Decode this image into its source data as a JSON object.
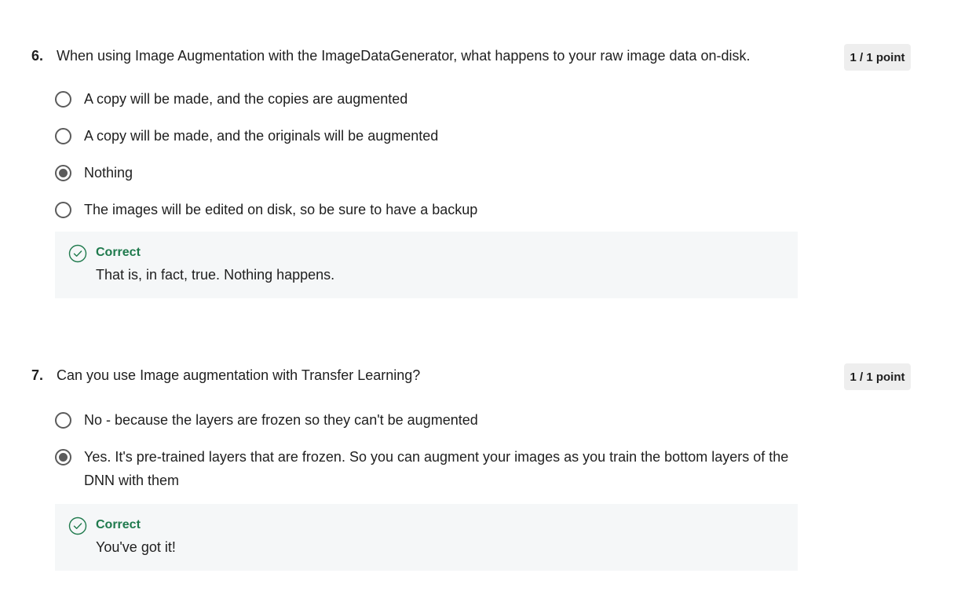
{
  "questions": [
    {
      "number": "6.",
      "text": "When using Image Augmentation with the ImageDataGenerator, what happens to your raw image data on-disk.",
      "points": "1 / 1 point",
      "options": [
        {
          "label": "A copy will be made, and the copies are augmented",
          "selected": false
        },
        {
          "label": "A copy will be made, and the originals will be augmented",
          "selected": false
        },
        {
          "label": "Nothing",
          "selected": true
        },
        {
          "label": "The images will be edited on disk, so be sure to have a backup",
          "selected": false
        }
      ],
      "feedback": {
        "title": "Correct",
        "text": "That is, in fact, true. Nothing happens."
      }
    },
    {
      "number": "7.",
      "text": "Can you use Image augmentation with Transfer Learning?",
      "points": "1 / 1 point",
      "options": [
        {
          "label": "No - because the layers are frozen so they can't be augmented",
          "selected": false
        },
        {
          "label": "Yes. It's pre-trained layers that are frozen. So you can augment your images as you train the bottom layers of the DNN with them",
          "selected": true
        }
      ],
      "feedback": {
        "title": "Correct",
        "text": "You've got it!"
      }
    }
  ],
  "colors": {
    "correct_green": "#1f7a4d",
    "feedback_bg": "#f5f7f8",
    "badge_bg": "#eeeeee",
    "radio_border": "#5b5b5b"
  },
  "icons": {
    "radio_unselected": "radio-unselected-icon",
    "radio_selected": "radio-selected-icon",
    "feedback": "check-circle-icon"
  }
}
